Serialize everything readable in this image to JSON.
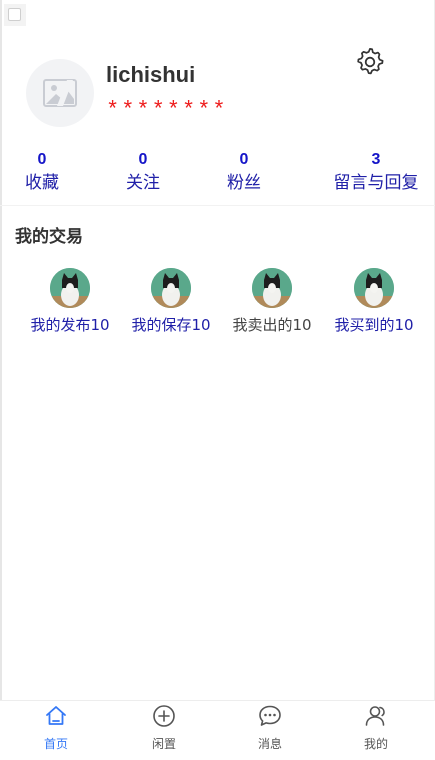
{
  "profile": {
    "username": "lichishui",
    "password_masked": "********"
  },
  "stats": [
    {
      "count": "0",
      "label": "收藏"
    },
    {
      "count": "0",
      "label": "关注"
    },
    {
      "count": "0",
      "label": "粉丝"
    },
    {
      "count": "3",
      "label": "留言与回复"
    }
  ],
  "trades": {
    "title": "我的交易",
    "items": [
      {
        "label": "我的发布10",
        "color": "#2020a8"
      },
      {
        "label": "我的保存10",
        "color": "#2020a8"
      },
      {
        "label": "我卖出的10",
        "color": "#444444"
      },
      {
        "label": "我买到的10",
        "color": "#2020a8"
      }
    ]
  },
  "tabbar": {
    "items": [
      {
        "label": "首页",
        "icon": "home-icon",
        "active": true
      },
      {
        "label": "闲置",
        "icon": "plus-circle-icon",
        "active": false
      },
      {
        "label": "消息",
        "icon": "chat-bubble-icon",
        "active": false
      },
      {
        "label": "我的",
        "icon": "user-icon",
        "active": false
      }
    ]
  },
  "colors": {
    "accent": "#3478f6",
    "stat_text": "#2020a8",
    "password": "#ee1c1c"
  }
}
